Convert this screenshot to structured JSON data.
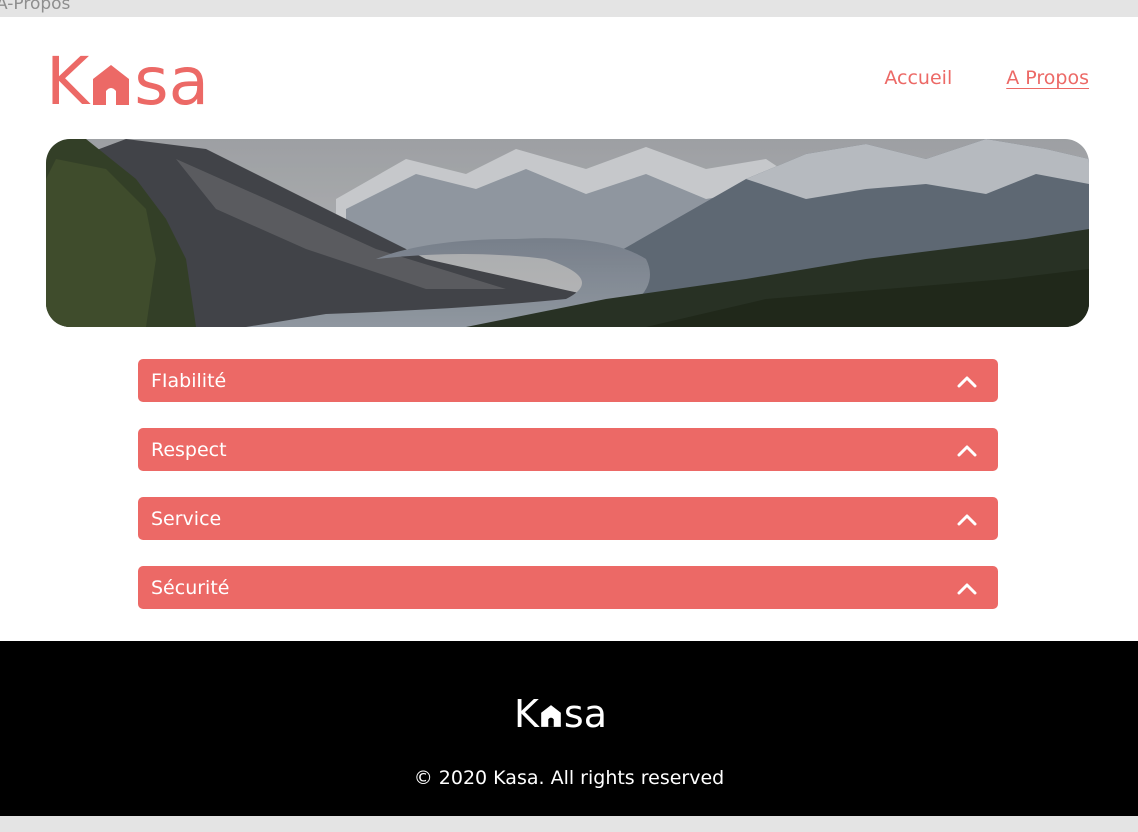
{
  "tab": {
    "title": "A-Propos"
  },
  "header": {
    "logo_letters": [
      "K",
      "sa"
    ],
    "nav": [
      {
        "label": "Accueil",
        "active": false
      },
      {
        "label": "A Propos",
        "active": true
      }
    ]
  },
  "banner": {
    "image": "mountain-landscape"
  },
  "accordions": [
    {
      "title": "FIabilité",
      "icon": "chevron-up-icon"
    },
    {
      "title": "Respect",
      "icon": "chevron-up-icon"
    },
    {
      "title": "Service",
      "icon": "chevron-up-icon"
    },
    {
      "title": "Sécurité",
      "icon": "chevron-up-icon"
    }
  ],
  "footer": {
    "logo_letters": [
      "K",
      "sa"
    ],
    "copyright": "© 2020 Kasa. All rights reserved"
  },
  "colors": {
    "brand": "#ec6966",
    "footer_bg": "#000000",
    "text_on_brand": "#ffffff"
  }
}
